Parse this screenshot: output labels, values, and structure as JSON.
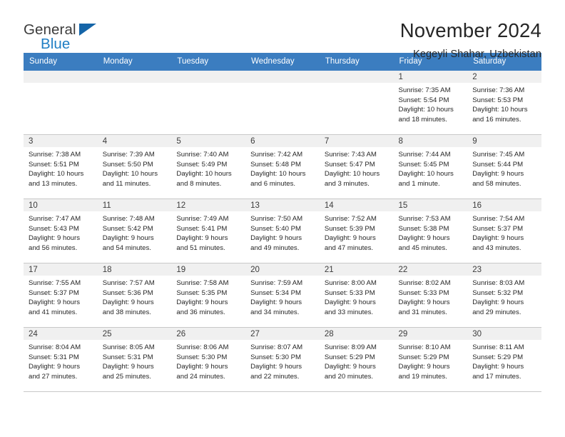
{
  "brand": {
    "name_part1": "General",
    "name_part2": "Blue",
    "triangle_color": "#1565a8",
    "blue_color": "#1f7ec4"
  },
  "header": {
    "title": "November 2024",
    "subtitle": "Kegeyli Shahar, Uzbekistan"
  },
  "theme": {
    "header_row_bg": "#3b7dc0",
    "daynum_bg": "#f0f0f0",
    "grid_line": "#c8c8c8"
  },
  "weekdays": [
    "Sunday",
    "Monday",
    "Tuesday",
    "Wednesday",
    "Thursday",
    "Friday",
    "Saturday"
  ],
  "weeks": [
    [
      {
        "day": "",
        "lines": []
      },
      {
        "day": "",
        "lines": []
      },
      {
        "day": "",
        "lines": []
      },
      {
        "day": "",
        "lines": []
      },
      {
        "day": "",
        "lines": []
      },
      {
        "day": "1",
        "lines": [
          "Sunrise: 7:35 AM",
          "Sunset: 5:54 PM",
          "Daylight: 10 hours",
          "and 18 minutes."
        ]
      },
      {
        "day": "2",
        "lines": [
          "Sunrise: 7:36 AM",
          "Sunset: 5:53 PM",
          "Daylight: 10 hours",
          "and 16 minutes."
        ]
      }
    ],
    [
      {
        "day": "3",
        "lines": [
          "Sunrise: 7:38 AM",
          "Sunset: 5:51 PM",
          "Daylight: 10 hours",
          "and 13 minutes."
        ]
      },
      {
        "day": "4",
        "lines": [
          "Sunrise: 7:39 AM",
          "Sunset: 5:50 PM",
          "Daylight: 10 hours",
          "and 11 minutes."
        ]
      },
      {
        "day": "5",
        "lines": [
          "Sunrise: 7:40 AM",
          "Sunset: 5:49 PM",
          "Daylight: 10 hours",
          "and 8 minutes."
        ]
      },
      {
        "day": "6",
        "lines": [
          "Sunrise: 7:42 AM",
          "Sunset: 5:48 PM",
          "Daylight: 10 hours",
          "and 6 minutes."
        ]
      },
      {
        "day": "7",
        "lines": [
          "Sunrise: 7:43 AM",
          "Sunset: 5:47 PM",
          "Daylight: 10 hours",
          "and 3 minutes."
        ]
      },
      {
        "day": "8",
        "lines": [
          "Sunrise: 7:44 AM",
          "Sunset: 5:45 PM",
          "Daylight: 10 hours",
          "and 1 minute."
        ]
      },
      {
        "day": "9",
        "lines": [
          "Sunrise: 7:45 AM",
          "Sunset: 5:44 PM",
          "Daylight: 9 hours",
          "and 58 minutes."
        ]
      }
    ],
    [
      {
        "day": "10",
        "lines": [
          "Sunrise: 7:47 AM",
          "Sunset: 5:43 PM",
          "Daylight: 9 hours",
          "and 56 minutes."
        ]
      },
      {
        "day": "11",
        "lines": [
          "Sunrise: 7:48 AM",
          "Sunset: 5:42 PM",
          "Daylight: 9 hours",
          "and 54 minutes."
        ]
      },
      {
        "day": "12",
        "lines": [
          "Sunrise: 7:49 AM",
          "Sunset: 5:41 PM",
          "Daylight: 9 hours",
          "and 51 minutes."
        ]
      },
      {
        "day": "13",
        "lines": [
          "Sunrise: 7:50 AM",
          "Sunset: 5:40 PM",
          "Daylight: 9 hours",
          "and 49 minutes."
        ]
      },
      {
        "day": "14",
        "lines": [
          "Sunrise: 7:52 AM",
          "Sunset: 5:39 PM",
          "Daylight: 9 hours",
          "and 47 minutes."
        ]
      },
      {
        "day": "15",
        "lines": [
          "Sunrise: 7:53 AM",
          "Sunset: 5:38 PM",
          "Daylight: 9 hours",
          "and 45 minutes."
        ]
      },
      {
        "day": "16",
        "lines": [
          "Sunrise: 7:54 AM",
          "Sunset: 5:37 PM",
          "Daylight: 9 hours",
          "and 43 minutes."
        ]
      }
    ],
    [
      {
        "day": "17",
        "lines": [
          "Sunrise: 7:55 AM",
          "Sunset: 5:37 PM",
          "Daylight: 9 hours",
          "and 41 minutes."
        ]
      },
      {
        "day": "18",
        "lines": [
          "Sunrise: 7:57 AM",
          "Sunset: 5:36 PM",
          "Daylight: 9 hours",
          "and 38 minutes."
        ]
      },
      {
        "day": "19",
        "lines": [
          "Sunrise: 7:58 AM",
          "Sunset: 5:35 PM",
          "Daylight: 9 hours",
          "and 36 minutes."
        ]
      },
      {
        "day": "20",
        "lines": [
          "Sunrise: 7:59 AM",
          "Sunset: 5:34 PM",
          "Daylight: 9 hours",
          "and 34 minutes."
        ]
      },
      {
        "day": "21",
        "lines": [
          "Sunrise: 8:00 AM",
          "Sunset: 5:33 PM",
          "Daylight: 9 hours",
          "and 33 minutes."
        ]
      },
      {
        "day": "22",
        "lines": [
          "Sunrise: 8:02 AM",
          "Sunset: 5:33 PM",
          "Daylight: 9 hours",
          "and 31 minutes."
        ]
      },
      {
        "day": "23",
        "lines": [
          "Sunrise: 8:03 AM",
          "Sunset: 5:32 PM",
          "Daylight: 9 hours",
          "and 29 minutes."
        ]
      }
    ],
    [
      {
        "day": "24",
        "lines": [
          "Sunrise: 8:04 AM",
          "Sunset: 5:31 PM",
          "Daylight: 9 hours",
          "and 27 minutes."
        ]
      },
      {
        "day": "25",
        "lines": [
          "Sunrise: 8:05 AM",
          "Sunset: 5:31 PM",
          "Daylight: 9 hours",
          "and 25 minutes."
        ]
      },
      {
        "day": "26",
        "lines": [
          "Sunrise: 8:06 AM",
          "Sunset: 5:30 PM",
          "Daylight: 9 hours",
          "and 24 minutes."
        ]
      },
      {
        "day": "27",
        "lines": [
          "Sunrise: 8:07 AM",
          "Sunset: 5:30 PM",
          "Daylight: 9 hours",
          "and 22 minutes."
        ]
      },
      {
        "day": "28",
        "lines": [
          "Sunrise: 8:09 AM",
          "Sunset: 5:29 PM",
          "Daylight: 9 hours",
          "and 20 minutes."
        ]
      },
      {
        "day": "29",
        "lines": [
          "Sunrise: 8:10 AM",
          "Sunset: 5:29 PM",
          "Daylight: 9 hours",
          "and 19 minutes."
        ]
      },
      {
        "day": "30",
        "lines": [
          "Sunrise: 8:11 AM",
          "Sunset: 5:29 PM",
          "Daylight: 9 hours",
          "and 17 minutes."
        ]
      }
    ]
  ]
}
